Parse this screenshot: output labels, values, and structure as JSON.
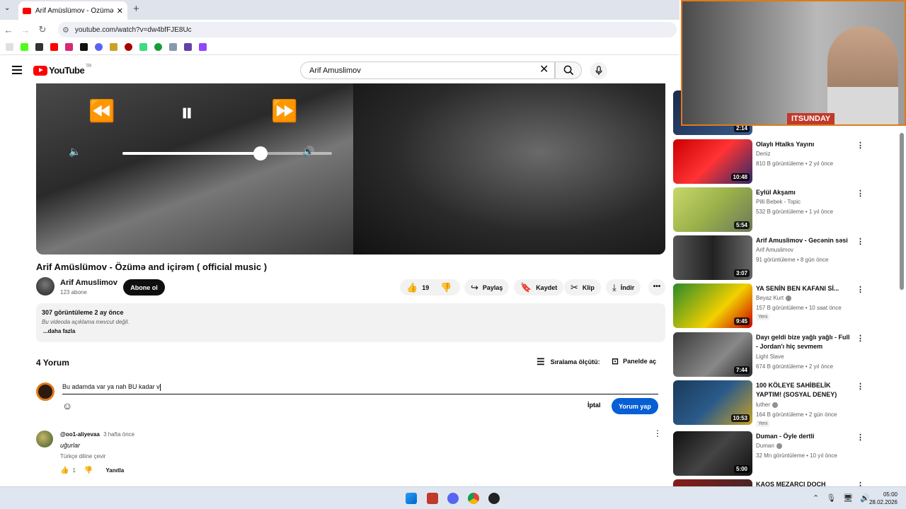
{
  "browser": {
    "tab_title": "Arif Amüslümov - Özümə a",
    "tab_close": "✕",
    "new_tab": "+",
    "url": "youtube.com/watch?v=dw4bfFJE8Uc"
  },
  "header": {
    "logo_text": "YouTube",
    "country_code": "TR",
    "search_value": "Arif Amuslimov"
  },
  "video": {
    "title": "Arif Amüslümov - Özümə and içirəm ( official music )",
    "channel": "Arif Amuslimov",
    "subscribers": "123 abone",
    "subscribe_label": "Abone ol",
    "likes": "19",
    "share_label": "Paylaş",
    "save_label": "Kaydet",
    "clip_label": "Klip",
    "download_label": "İndir",
    "more_label": "•••",
    "volume_level": 0.66
  },
  "description": {
    "meta": "307 görüntüleme  2 ay önce",
    "empty_text": "Bu videoda açıklama mevcut değil.",
    "more_label": "...daha fazla"
  },
  "comments": {
    "count_label": "4 Yorum",
    "sort_label": "Sıralama ölçütü:",
    "panel_label": "Panelde aç",
    "input_value": "Bu adamda var ya nah BU kadar v",
    "cancel_label": "İptal",
    "submit_label": "Yorum yap",
    "items": [
      {
        "author": "@oo1-aliyevaa",
        "time": "3 hafta önce",
        "text": "uğurlar",
        "translate": "Türkçe diline çevir",
        "likes": "1",
        "reply_label": "Yanıtla"
      }
    ]
  },
  "recommendations": [
    {
      "title": "",
      "channel": "",
      "views": "",
      "duration": "2:14",
      "badge": ""
    },
    {
      "title": "Olaylı Htalks Yayını",
      "channel": "Deniz",
      "views": "810 B görüntüleme • 2 yıl önce",
      "duration": "10:48",
      "badge": ""
    },
    {
      "title": "Eylül Akşamı",
      "channel": "Pilli Bebek - Topic",
      "views": "532 B görüntüleme • 1 yıl önce",
      "duration": "5:54",
      "badge": ""
    },
    {
      "title": "Arif Amuslimov - Gecənin səsi",
      "channel": "Arif Amuslimov",
      "views": "91 görüntüleme • 8 gün önce",
      "duration": "3:07",
      "badge": ""
    },
    {
      "title": "YA SENİN BEN KAFANI Sİ...",
      "channel": "Beyaz Kurt",
      "views": "157 B görüntüleme • 10 saat önce",
      "duration": "9:45",
      "badge": "Yeni"
    },
    {
      "title": "Dayı geldi bize yağlı yağlı - Full - Jordan'ı hiç sevmem",
      "channel": "Light Slave",
      "views": "674 B görüntüleme • 2 yıl önce",
      "duration": "7:44",
      "badge": ""
    },
    {
      "title": "100 KÖLEYE SAHİBELİK YAPTIM! (SOSYAL DENEY)",
      "channel": "luther",
      "views": "164 B görüntüleme • 2 gün önce",
      "duration": "10:53",
      "badge": "Yeni"
    },
    {
      "title": "Duman - Öyle dertli",
      "channel": "Duman",
      "views": "32 Mn görüntüleme • 10 yıl önce",
      "duration": "5:00",
      "badge": ""
    },
    {
      "title": "KAOS MEZARCI DOCH KAVGA!!",
      "channel": "",
      "views": "",
      "duration": "",
      "badge": ""
    }
  ],
  "webcam": {
    "label": "ITSUNDAY"
  },
  "taskbar": {
    "time": "05:00",
    "date": "28.02.2026"
  },
  "colors": {
    "accent": "#065fd4",
    "brand": "#ff0000",
    "webcam_border": "#e07a1a"
  }
}
